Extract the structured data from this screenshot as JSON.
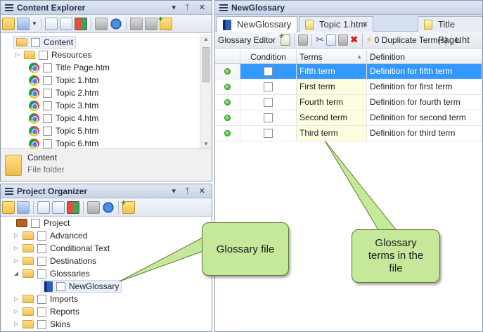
{
  "content_explorer": {
    "title": "Content Explorer",
    "pin_glyphs": "▾ ᛘ ✕",
    "root": "Content",
    "items": [
      {
        "label": "Resources",
        "type": "folder"
      },
      {
        "label": "Title Page.htm",
        "type": "htm"
      },
      {
        "label": "Topic 1.htm",
        "type": "htm"
      },
      {
        "label": "Topic 2.htm",
        "type": "htm"
      },
      {
        "label": "Topic 3.htm",
        "type": "htm"
      },
      {
        "label": "Topic 4.htm",
        "type": "htm"
      },
      {
        "label": "Topic 5.htm",
        "type": "htm"
      },
      {
        "label": "Topic 6.htm",
        "type": "htm"
      }
    ],
    "details": {
      "name": "Content",
      "type": "File folder"
    }
  },
  "project_organizer": {
    "title": "Project Organizer",
    "pin_glyphs": "▾ ᛘ ✕",
    "root": "Project",
    "items": [
      {
        "label": "Advanced",
        "expander": "▷"
      },
      {
        "label": "Conditional Text",
        "expander": "▷"
      },
      {
        "label": "Destinations",
        "expander": "▷"
      },
      {
        "label": "Glossaries",
        "expander": "◢"
      },
      {
        "label": "Imports",
        "expander": "▷"
      },
      {
        "label": "Reports",
        "expander": "▷"
      },
      {
        "label": "Skins",
        "expander": "▷"
      }
    ],
    "selected_child": "NewGlossary"
  },
  "editor": {
    "window_title": "NewGlossary",
    "tabs": [
      {
        "label": "NewGlossary",
        "active": true
      },
      {
        "label": "Topic 1.htm",
        "active": false
      },
      {
        "label": "Title Page.ht",
        "active": false
      }
    ],
    "toolbar_label": "Glossary Editor",
    "duplicate_label": "0 Duplicate Term(s)",
    "overflow_label": "U",
    "columns": {
      "condition": "Condition",
      "terms": "Terms",
      "definition": "Definition"
    },
    "rows": [
      {
        "term": "Fifth term",
        "definition": "Definition for fifth term",
        "selected": true
      },
      {
        "term": "First term",
        "definition": "Definition for first term",
        "selected": false
      },
      {
        "term": "Fourth term",
        "definition": "Definition for fourth term",
        "selected": false
      },
      {
        "term": "Second term",
        "definition": "Definition for second term",
        "selected": false
      },
      {
        "term": "Third term",
        "definition": "Definition for third term",
        "selected": false
      }
    ]
  },
  "callouts": {
    "glossary_file": "Glossary file",
    "glossary_terms": "Glossary terms in the file"
  },
  "colors": {
    "callout_fill": "#c6e89a",
    "selection": "#3399ff",
    "term_fill": "#fffde0"
  }
}
